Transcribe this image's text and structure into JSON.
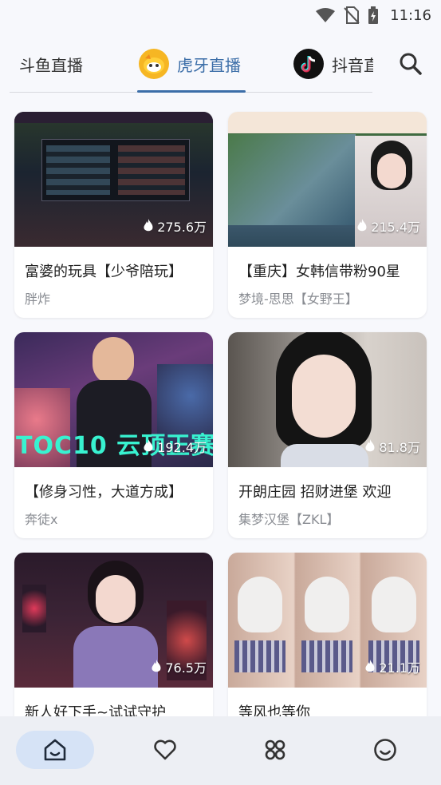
{
  "status_bar": {
    "time": "11:16"
  },
  "tabs": [
    {
      "label": "斗鱼直播",
      "active": false
    },
    {
      "label": "虎牙直播",
      "active": true
    },
    {
      "label": "抖音直播",
      "active": false
    }
  ],
  "accent_color": "#3c6ea8",
  "cards": [
    {
      "title": "富婆的玩具【少爷陪玩】",
      "streamer": "胖炸",
      "views": "275.6万"
    },
    {
      "title": "【重庆】女韩信带粉90星",
      "streamer": "梦境-思思【女野王】",
      "views": "215.4万"
    },
    {
      "title": "【修身习性，大道方成】",
      "streamer": "奔徒x",
      "views": "192.4万"
    },
    {
      "title": "开朗庄园 招财进堡 欢迎",
      "streamer": "集梦汉堡【ZKL】",
      "views": "81.8万"
    },
    {
      "title": "新人好下手~试试守护",
      "streamer": "",
      "views": "76.5万"
    },
    {
      "title": "等风也等你",
      "streamer": "",
      "views": "21.1万"
    }
  ],
  "thumb_text": {
    "toc": "TOC10 云顶正赛"
  },
  "bottom_nav": [
    {
      "icon": "home-icon",
      "active": true
    },
    {
      "icon": "heart-icon",
      "active": false
    },
    {
      "icon": "category-icon",
      "active": false
    },
    {
      "icon": "smile-icon",
      "active": false
    }
  ]
}
